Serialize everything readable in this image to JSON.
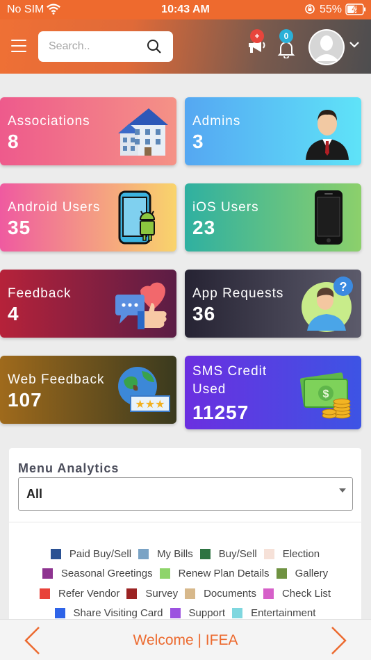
{
  "status_bar": {
    "carrier": "No SIM",
    "time": "10:43 AM",
    "battery_percent": "55%"
  },
  "header": {
    "search_placeholder": "Search..",
    "announcement_badge": "+",
    "notification_badge": "0"
  },
  "cards": [
    {
      "label": "Associations",
      "value": "8",
      "icon": "building-icon"
    },
    {
      "label": "Admins",
      "value": "3",
      "icon": "businessman-icon"
    },
    {
      "label": "Android Users",
      "value": "35",
      "icon": "android-phone-icon"
    },
    {
      "label": "iOS Users",
      "value": "23",
      "icon": "iphone-icon"
    },
    {
      "label": "Feedback",
      "value": "4",
      "icon": "feedback-icon"
    },
    {
      "label": "App Requests",
      "value": "36",
      "icon": "question-person-icon"
    },
    {
      "label": "Web Feedback",
      "value": "107",
      "icon": "globe-rating-icon"
    },
    {
      "label": "SMS Credit Used",
      "value": "11257",
      "icon": "money-icon"
    }
  ],
  "analytics": {
    "title": "Menu Analytics",
    "selected": "All",
    "legend": [
      {
        "label": "Paid Buy/Sell",
        "color": "#2a5193"
      },
      {
        "label": "My Bills",
        "color": "#7aa3c5"
      },
      {
        "label": "Buy/Sell",
        "color": "#2e7442"
      },
      {
        "label": "Election",
        "color": "#f6e1d8"
      },
      {
        "label": "Seasonal Greetings",
        "color": "#8e3390"
      },
      {
        "label": "Renew Plan Details",
        "color": "#8ed46a"
      },
      {
        "label": "Gallery",
        "color": "#6f9241"
      },
      {
        "label": "Refer Vendor",
        "color": "#e8423a"
      },
      {
        "label": "Survey",
        "color": "#9b2323"
      },
      {
        "label": "Documents",
        "color": "#d7b88b"
      },
      {
        "label": "Check List",
        "color": "#d660c9"
      },
      {
        "label": "Share Visiting Card",
        "color": "#2f64e8"
      },
      {
        "label": "Support",
        "color": "#9c52e0"
      },
      {
        "label": "Entertainment",
        "color": "#7fd7df"
      }
    ]
  },
  "footer": {
    "title": "Welcome | IFEA"
  },
  "colors": {
    "accent": "#ec6a2f"
  }
}
